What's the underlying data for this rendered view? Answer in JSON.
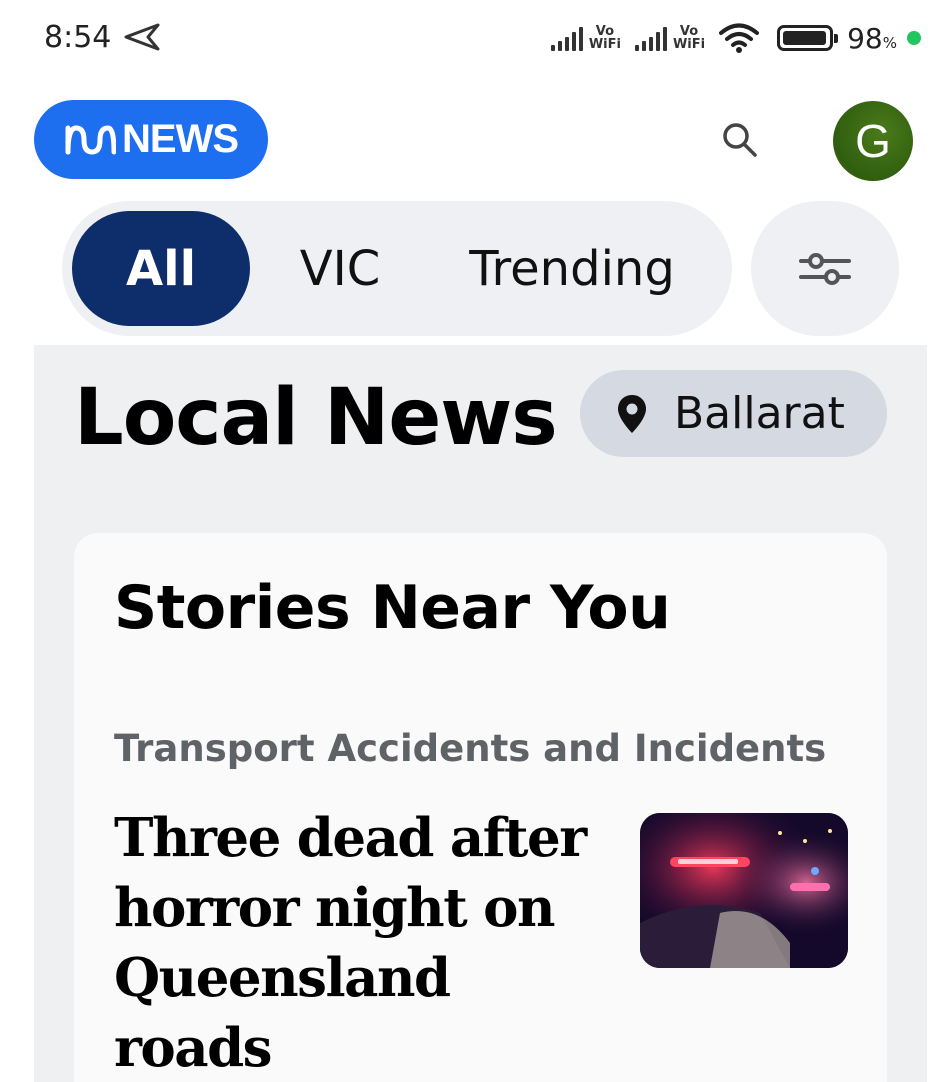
{
  "status_bar": {
    "time": "8:54",
    "vowifi_top": "Vo",
    "vowifi_bottom": "WiFi",
    "battery_percent": "98",
    "battery_unit": "%",
    "battery_level": 0.98
  },
  "header": {
    "logo_text": "NEWS",
    "avatar_initial": "G",
    "brand_color": "#1e6ff0"
  },
  "tabs": [
    {
      "label": "All",
      "active": true
    },
    {
      "label": "VIC",
      "active": false
    },
    {
      "label": "Trending",
      "active": false
    }
  ],
  "local": {
    "title": "Local News",
    "location": "Ballarat"
  },
  "card": {
    "title": "Stories Near You",
    "story": {
      "category": "Transport Accidents and Incidents",
      "headline": "Three dead after horror night on Queensland roads"
    }
  },
  "icons": {
    "search": "search-icon",
    "filter": "sliders-icon",
    "location": "location-pin-icon"
  }
}
